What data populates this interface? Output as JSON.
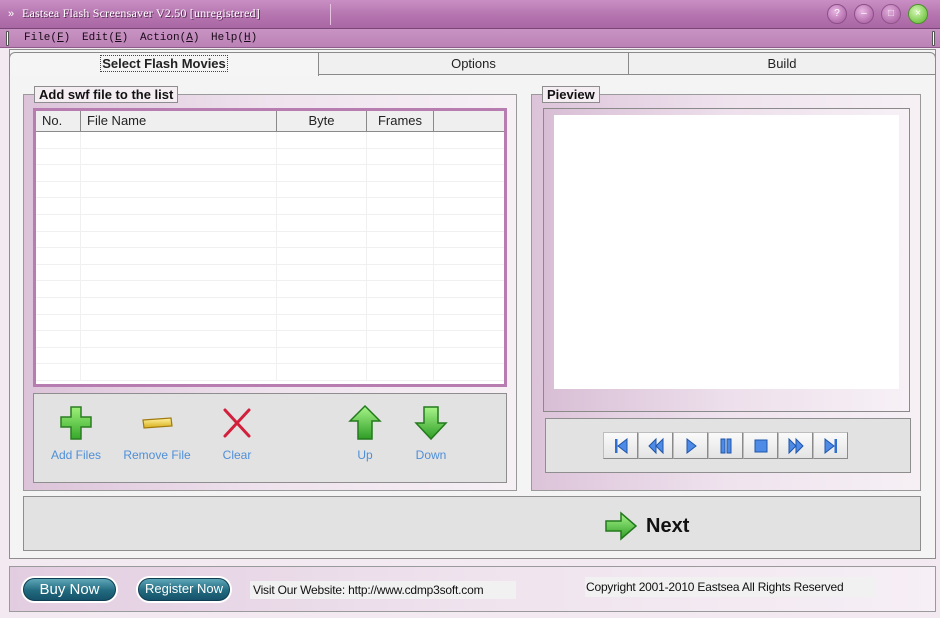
{
  "window": {
    "title": "Eastsea Flash Screensaver V2.50 [unregistered]",
    "controls": [
      "help",
      "minimize",
      "maximize",
      "close"
    ]
  },
  "menu": {
    "items": [
      {
        "label": "File",
        "accel": "F"
      },
      {
        "label": "Edit",
        "accel": "E"
      },
      {
        "label": "Action",
        "accel": "A"
      },
      {
        "label": "Help",
        "accel": "H"
      }
    ]
  },
  "tabs": [
    {
      "label": "Select Flash Movies",
      "active": true
    },
    {
      "label": "Options",
      "active": false
    },
    {
      "label": "Build",
      "active": false
    }
  ],
  "files_group": {
    "legend": "Add swf file to the list",
    "columns": [
      "No.",
      "File Name",
      "Byte",
      "Frames",
      ""
    ],
    "rows": [],
    "toolbar": [
      {
        "id": "add",
        "label": "Add Files",
        "icon": "green-plus-icon"
      },
      {
        "id": "remove",
        "label": "Remove File",
        "icon": "yellow-minus-icon"
      },
      {
        "id": "clear",
        "label": "Clear",
        "icon": "red-x-icon"
      },
      {
        "id": "up",
        "label": "Up",
        "icon": "green-up-arrow-icon"
      },
      {
        "id": "down",
        "label": "Down",
        "icon": "green-down-arrow-icon"
      }
    ]
  },
  "preview_group": {
    "legend": "Pieview",
    "player_controls": [
      "first",
      "rewind",
      "play",
      "pause",
      "stop",
      "fast-forward",
      "last"
    ]
  },
  "next": {
    "label": "Next",
    "icon": "green-right-arrow-icon"
  },
  "footer": {
    "buy_label": "Buy Now",
    "register_label": "Register Now",
    "website_text": "Visit Our Website: http://www.cdmp3soft.com",
    "copyright_text": "Copyright 2001-2010 Eastsea All Rights Reserved"
  },
  "colors": {
    "title_bar": "#b676b0",
    "accent_border": "#b77db1",
    "link_blue": "#4f8fd8",
    "player_blue": "#2f6fd0",
    "pill_teal": "#226a7f"
  }
}
